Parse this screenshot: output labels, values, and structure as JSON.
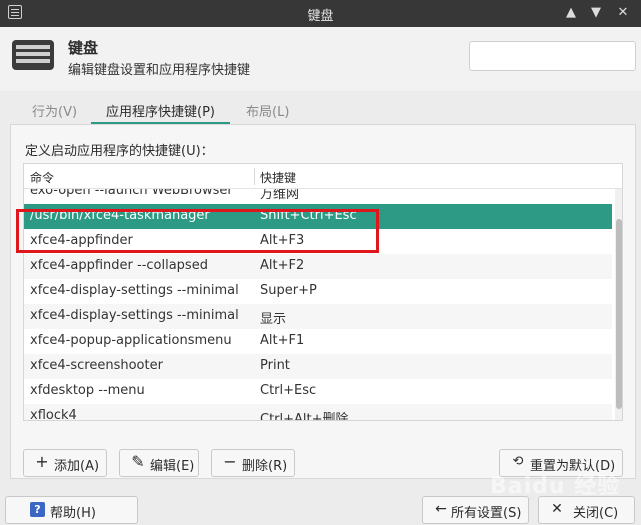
{
  "window": {
    "title": "键盘",
    "controls": [
      "▲",
      "▼",
      "✕"
    ]
  },
  "header": {
    "title": "键盘",
    "subtitle": "编辑键盘设置和应用程序快捷键",
    "search_placeholder": ""
  },
  "tabs": [
    {
      "label": "行为(V)",
      "active": false
    },
    {
      "label": "应用程序快捷键(P)",
      "active": true
    },
    {
      "label": "布局(L)",
      "active": false
    }
  ],
  "panel": {
    "label": "定义启动应用程序的快捷键(U)："
  },
  "table": {
    "columns": {
      "command": "命令",
      "shortcut": "快捷键"
    },
    "rows": [
      {
        "command": "exo-open --launch WebBrowser",
        "shortcut": "万维网"
      },
      {
        "command": "/usr/bin/xfce4-taskmanager",
        "shortcut": "Shift+Ctrl+Esc"
      },
      {
        "command": "xfce4-appfinder",
        "shortcut": "Alt+F3"
      },
      {
        "command": "xfce4-appfinder --collapsed",
        "shortcut": "Alt+F2"
      },
      {
        "command": "xfce4-display-settings --minimal",
        "shortcut": "Super+P"
      },
      {
        "command": "xfce4-display-settings --minimal",
        "shortcut": "显示"
      },
      {
        "command": "xfce4-popup-applicationsmenu",
        "shortcut": "Alt+F1"
      },
      {
        "command": "xfce4-screenshooter",
        "shortcut": "Print"
      },
      {
        "command": "xfdesktop --menu",
        "shortcut": "Ctrl+Esc"
      },
      {
        "command": "xflock4",
        "shortcut": "Ctrl+Alt+删除"
      }
    ],
    "selected_index": 1
  },
  "actions": {
    "add": "添加(A)",
    "edit": "编辑(E)",
    "delete": "删除(R)",
    "reset": "重置为默认(D)"
  },
  "footer": {
    "help": "帮助(H)",
    "all_settings": "所有设置(S)",
    "close": "关闭(C)"
  },
  "watermark": "Baidu 经验",
  "colors": {
    "accent": "#2d9a86",
    "highlight_box": "#e0161d",
    "titlebar": "#373737"
  }
}
